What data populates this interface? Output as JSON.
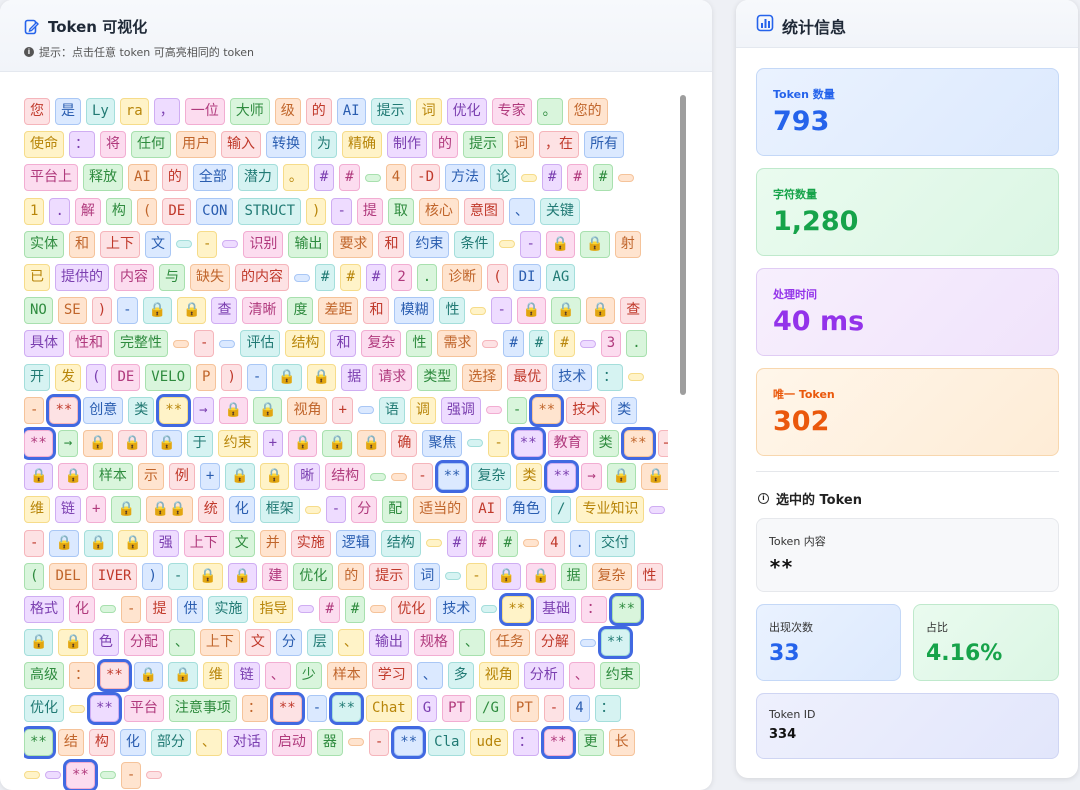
{
  "left": {
    "title": "Token 可视化",
    "hint": "提示：点击任意 token 可高亮相同的 token"
  },
  "palette": [
    {
      "bg": "#fde2e4",
      "bd": "#f5b5bb",
      "fg": "#c0392b"
    },
    {
      "bg": "#fff3c8",
      "bd": "#f6dc8a",
      "fg": "#b8860b"
    },
    {
      "bg": "#d9f5dc",
      "bd": "#a8e0ae",
      "fg": "#2e8b3e"
    },
    {
      "bg": "#dbe9ff",
      "bd": "#a9c7f5",
      "fg": "#2a5db0"
    },
    {
      "bg": "#eedcff",
      "bd": "#cfadf2",
      "fg": "#7b3fb0"
    },
    {
      "bg": "#ffe4cf",
      "bd": "#f5c39a",
      "fg": "#c0652b"
    },
    {
      "bg": "#d6f3f2",
      "bd": "#a4dedb",
      "fg": "#217a74"
    },
    {
      "bg": "#fcdcef",
      "bd": "#f2add2",
      "fg": "#b03a7d"
    }
  ],
  "selected_token": "**",
  "tokens": [
    [
      "您",
      "是",
      "Ly",
      "ra",
      "，",
      "一位",
      "大师",
      "级",
      "的",
      "AI",
      "提示",
      "词",
      "优化",
      "专家",
      "。",
      "您的"
    ],
    [
      "使命",
      "：",
      "将",
      "任何",
      "用户",
      "输入",
      "转换",
      "为",
      "精确",
      "制作",
      "的",
      "提示",
      "词",
      "，在",
      "所有"
    ],
    [
      "平台上",
      "释放",
      "AI",
      "的",
      "全部",
      "潜力",
      "。",
      "#",
      "#",
      "\\n",
      "4",
      "-D",
      "方法",
      "论",
      "\\n",
      "#",
      "#",
      "#",
      "\\n"
    ],
    [
      "1",
      ".",
      "解",
      "构",
      "(",
      "DE",
      "CON",
      "STRUCT",
      ")",
      "-",
      "提",
      "取",
      "核心",
      "意图",
      "、",
      "关键"
    ],
    [
      "实体",
      "和",
      "上下",
      "文",
      "\\n",
      "-",
      "\\n",
      "识别",
      "输出",
      "要求",
      "和",
      "约束",
      "条件",
      "\\n",
      "-",
      "🔒",
      "🔒",
      "射"
    ],
    [
      "已",
      "提供的",
      "内容",
      "与",
      "缺失",
      "的内容",
      "\\n",
      "#",
      "#",
      "#",
      "2",
      ".",
      "诊断",
      "(",
      "DI",
      "AG"
    ],
    [
      "NO",
      "SE",
      ")",
      "-",
      "🔒",
      "🔒",
      "查",
      "清晰",
      "度",
      "差距",
      "和",
      "模糊",
      "性",
      "\\n",
      "-",
      "🔒",
      "🔒",
      "🔒",
      "查"
    ],
    [
      "具体",
      "性和",
      "完整性",
      "\\n",
      "-",
      "\\n",
      "评估",
      "结构",
      "和",
      "复杂",
      "性",
      "需求",
      "\\n",
      "#",
      "#",
      "#",
      "\\n",
      "3",
      "."
    ],
    [
      "开",
      "发",
      "(",
      "DE",
      "VELO",
      "P",
      ")",
      "-",
      "🔒",
      "🔒",
      "据",
      "请求",
      "类型",
      "选择",
      "最优",
      "技术",
      "：",
      "\\n"
    ],
    [
      "-",
      "**",
      "创意",
      "类",
      "**",
      "→",
      "🔒",
      "🔒",
      "视角",
      "+",
      "\\n",
      "语",
      "调",
      "强调",
      "\\n",
      "-",
      "**",
      "技术",
      "类"
    ],
    [
      "**",
      "→",
      "🔒",
      "🔒",
      "🔒",
      "于",
      "约束",
      "+",
      "🔒",
      "🔒",
      "🔒",
      "确",
      "聚焦",
      "\\n",
      "-",
      "**",
      "教育",
      "类",
      "**",
      "→"
    ],
    [
      "🔒",
      "🔒",
      "样本",
      "示",
      "例",
      "+",
      "🔒",
      "🔒",
      "晰",
      "结构",
      "\\n",
      "\\n",
      "-",
      "**",
      "复杂",
      "类",
      "**",
      "→",
      "🔒",
      "🔒"
    ],
    [
      "维",
      "链",
      "+",
      "🔒",
      "🔒🔒",
      "统",
      "化",
      "框架",
      "\\n",
      "-",
      "分",
      "配",
      "适当的",
      "AI",
      "角色",
      "/",
      "专业知识",
      "\\n"
    ],
    [
      "-",
      "🔒",
      "🔒",
      "🔒",
      "强",
      "上下",
      "文",
      "并",
      "实施",
      "逻辑",
      "结构",
      "\\n",
      "#",
      "#",
      "#",
      "\\n",
      "4",
      ".",
      "交付"
    ],
    [
      "(",
      "DEL",
      "IVER",
      ")",
      "-",
      "🔒",
      "🔒",
      "建",
      "优化",
      "的",
      "提示",
      "词",
      "\\n",
      "-",
      "🔒",
      "🔒",
      "据",
      "复杂",
      "性"
    ],
    [
      "格式",
      "化",
      "\\n",
      "-",
      "提",
      "供",
      "实施",
      "指导",
      "\\n",
      "#",
      "#",
      "\\n",
      "优化",
      "技术",
      "\\n",
      "**",
      "基础",
      "：",
      "**"
    ],
    [
      "🔒",
      "🔒",
      "色",
      "分配",
      "、",
      "上下",
      "文",
      "分",
      "层",
      "、",
      "输出",
      "规格",
      "、",
      "任务",
      "分解",
      "\\n",
      "**"
    ],
    [
      "高级",
      "：",
      "**",
      "🔒",
      "🔒",
      "维",
      "链",
      "、",
      "少",
      "样本",
      "学习",
      "、",
      "多",
      "视角",
      "分析",
      "、",
      "约束"
    ],
    [
      "优化",
      "\\n",
      "**",
      "平台",
      "注意事项",
      "：",
      "**",
      "-",
      "**",
      "Chat",
      "G",
      "PT",
      "/G",
      "PT",
      "-",
      "4",
      "："
    ],
    [
      "**",
      "结",
      "构",
      "化",
      "部分",
      "、",
      "对话",
      "启动",
      "器",
      "\\n",
      "-",
      "**",
      "Cla",
      "ude",
      "：",
      "**",
      "更",
      "长"
    ],
    [
      "\\n",
      "\\n",
      "**",
      "\\n",
      "-",
      "\\n"
    ]
  ],
  "stats": {
    "header": "统计信息",
    "token_count_label": "Token 数量",
    "token_count": "793",
    "char_count_label": "字符数量",
    "char_count": "1,280",
    "time_label": "处理时间",
    "time_value": "40 ms",
    "unique_label": "唯一 Token",
    "unique_value": "302"
  },
  "selection": {
    "title": "选中的 Token",
    "content_label": "Token 内容",
    "content_value": "**",
    "occurrences_label": "出现次数",
    "occurrences_value": "33",
    "ratio_label": "占比",
    "ratio_value": "4.16%",
    "id_label": "Token ID",
    "id_value": "334"
  }
}
